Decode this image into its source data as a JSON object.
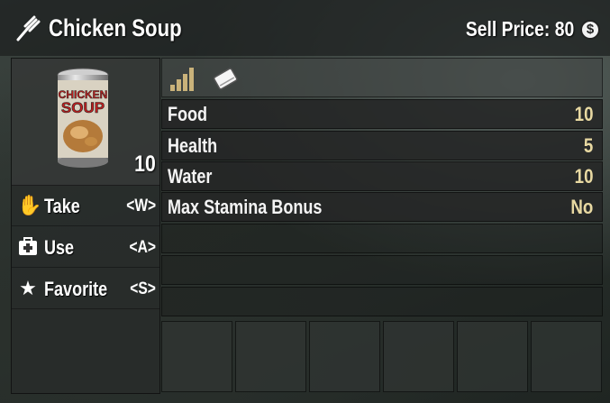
{
  "header": {
    "title": "Chicken Soup",
    "sell_price_label": "Sell Price: 80",
    "coin_icon": "coin-icon",
    "item_icon": "fork-icon"
  },
  "item": {
    "count": "10",
    "can_text_top": "CHICKEN",
    "can_text_bottom": "SOUP"
  },
  "actions": [
    {
      "label": "Take",
      "key": "<W>",
      "icon": "hand-icon"
    },
    {
      "label": "Use",
      "key": "<A>",
      "icon": "medkit-icon"
    },
    {
      "label": "Favorite",
      "key": "<S>",
      "icon": "star-icon"
    }
  ],
  "stat_icons": [
    "quality-bars-icon",
    "book-icon"
  ],
  "stats": [
    {
      "name": "Food",
      "value": "10"
    },
    {
      "name": "Health",
      "value": "5"
    },
    {
      "name": "Water",
      "value": "10"
    },
    {
      "name": "Max Stamina Bonus",
      "value": "No"
    }
  ],
  "colors": {
    "stat_value": "#e8d9a2",
    "quality": "#c9b27a"
  }
}
